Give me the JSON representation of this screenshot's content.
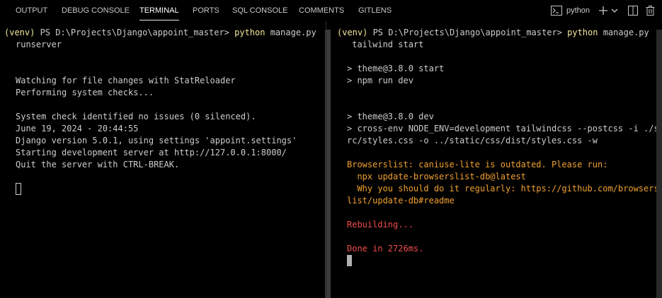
{
  "panel": {
    "tabs": [
      {
        "label": "OUTPUT"
      },
      {
        "label": "DEBUG CONSOLE"
      },
      {
        "label": "TERMINAL",
        "active": true
      },
      {
        "label": "PORTS"
      },
      {
        "label": "SQL CONSOLE"
      },
      {
        "label": "COMMENTS"
      },
      {
        "label": "GITLENS"
      }
    ],
    "actions": {
      "terminal_profile": "python",
      "icons": [
        "terminal-icon",
        "plus-icon",
        "chevron-down-icon",
        "split-icon",
        "trash-icon"
      ]
    }
  },
  "terminals": {
    "left": {
      "lines": [
        {
          "venv": "(venv)",
          "prompt": " PS D:\\Projects\\Django\\appoint_master> ",
          "cmd": "python",
          "rest": " manage.py"
        },
        {
          "text": "runserver"
        },
        {
          "text": "Watching for file changes with StatReloader"
        },
        {
          "text": "Performing system checks..."
        },
        {
          "text": "System check identified no issues (0 silenced)."
        },
        {
          "text": "June 19, 2024 - 20:44:55"
        },
        {
          "text": "Django version 5.0.1, using settings 'appoint.settings'"
        },
        {
          "text": "Starting development server at http://127.0.0.1:8000/"
        },
        {
          "text": "Quit the server with CTRL-BREAK."
        }
      ]
    },
    "right": {
      "lines": [
        {
          "venv": "(venv)",
          "prompt": " PS D:\\Projects\\Django\\appoint_master> ",
          "cmd": "python",
          "rest": " manage.py"
        },
        {
          "text": " tailwind start"
        },
        {
          "text": "> theme@3.8.0 start"
        },
        {
          "text": "> npm run dev"
        },
        {
          "text": "> theme@3.8.0 dev"
        },
        {
          "text": "> cross-env NODE_ENV=development tailwindcss --postcss -i ./s"
        },
        {
          "text": "rc/styles.css -o ../static/css/dist/styles.css -w"
        },
        {
          "text": "Browserslist: caniuse-lite is outdated. Please run:"
        },
        {
          "text": "  npx update-browserslist-db@latest"
        },
        {
          "text": "  Why you should do it regularly: https://github.com/browsers"
        },
        {
          "text": "list/update-db#readme"
        },
        {
          "text": "Rebuilding..."
        },
        {
          "text": "Done in 2726ms."
        }
      ]
    }
  },
  "colors": {
    "background": "#000000",
    "text": "#cccccc",
    "venv": "#f0e69a",
    "warning": "#f0a030",
    "error": "#f14c4c"
  }
}
